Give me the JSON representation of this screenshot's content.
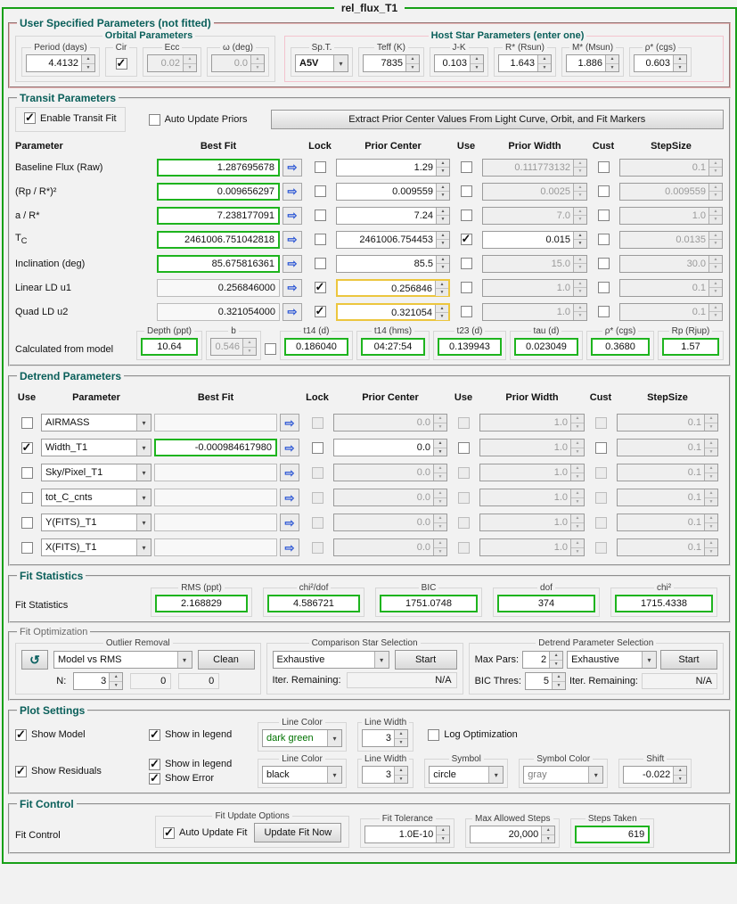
{
  "window_title": "rel_flux_T1",
  "icons": {
    "arrow_right": "⇨",
    "chevron_down": "▾",
    "undo": "↺"
  },
  "user_params": {
    "title": "User Specified Parameters (not fitted)",
    "orbital": {
      "title": "Orbital Parameters",
      "period_label": "Period (days)",
      "period_value": "4.4132",
      "cir_label": "Cir",
      "cir_checked": true,
      "ecc_label": "Ecc",
      "ecc_value": "0.02",
      "omega_label": "ω (deg)",
      "omega_value": "0.0"
    },
    "host_star": {
      "title": "Host Star Parameters (enter one)",
      "spt_label": "Sp.T.",
      "spt_value": "A5V",
      "teff_label": "Teff (K)",
      "teff_value": "7835",
      "jk_label": "J-K",
      "jk_value": "0.103",
      "rstar_label": "R* (Rsun)",
      "rstar_value": "1.643",
      "mstar_label": "M* (Msun)",
      "mstar_value": "1.886",
      "rho_label": "ρ* (cgs)",
      "rho_value": "0.603"
    }
  },
  "transit": {
    "title": "Transit Parameters",
    "enable_label": "Enable Transit Fit",
    "enable_checked": true,
    "auto_update_label": "Auto Update Priors",
    "auto_update_checked": false,
    "extract_button": "Extract Prior Center Values From Light Curve, Orbit, and Fit Markers",
    "headers": {
      "parameter": "Parameter",
      "best_fit": "Best Fit",
      "lock": "Lock",
      "prior_center": "Prior Center",
      "use": "Use",
      "prior_width": "Prior Width",
      "cust": "Cust",
      "stepsize": "StepSize"
    },
    "rows": [
      {
        "label": "Baseline Flux (Raw)",
        "best_fit": "1.287695678",
        "lock": false,
        "prior_center": "1.29",
        "use": false,
        "prior_width": "0.111773132",
        "cust": false,
        "stepsize": "0.1"
      },
      {
        "label": "(Rp / R*)²",
        "best_fit": "0.009656297",
        "lock": false,
        "prior_center": "0.009559",
        "use": false,
        "prior_width": "0.0025",
        "cust": false,
        "stepsize": "0.009559"
      },
      {
        "label": "a / R*",
        "best_fit": "7.238177091",
        "lock": false,
        "prior_center": "7.24",
        "use": false,
        "prior_width": "7.0",
        "cust": false,
        "stepsize": "1.0"
      },
      {
        "label": "T",
        "label_sub": "C",
        "best_fit": "2461006.751042818",
        "lock": false,
        "prior_center": "2461006.754453",
        "use": true,
        "prior_width": "0.015",
        "cust": false,
        "stepsize": "0.0135"
      },
      {
        "label": "Inclination (deg)",
        "best_fit": "85.675816361",
        "lock": false,
        "prior_center": "85.5",
        "use": false,
        "prior_width": "15.0",
        "cust": false,
        "stepsize": "30.0"
      },
      {
        "label": "Linear LD u1",
        "best_fit": "0.256846000",
        "lock": true,
        "prior_center": "0.256846",
        "use": false,
        "prior_width": "1.0",
        "cust": false,
        "stepsize": "0.1"
      },
      {
        "label": "Quad LD u2",
        "best_fit": "0.321054000",
        "lock": true,
        "prior_center": "0.321054",
        "use": false,
        "prior_width": "1.0",
        "cust": false,
        "stepsize": "0.1"
      }
    ],
    "calculated": {
      "label": "Calculated from model",
      "depth_label": "Depth (ppt)",
      "depth_value": "10.64",
      "b_label": "b",
      "b_value": "0.546",
      "t14d_label": "t14 (d)",
      "t14d_value": "0.186040",
      "t14hms_label": "t14 (hms)",
      "t14hms_value": "04:27:54",
      "t23_label": "t23 (d)",
      "t23_value": "0.139943",
      "tau_label": "tau (d)",
      "tau_value": "0.023049",
      "rho_label": "ρ* (cgs)",
      "rho_value": "0.3680",
      "rp_label": "Rp (Rjup)",
      "rp_value": "1.57"
    }
  },
  "detrend": {
    "title": "Detrend Parameters",
    "headers": {
      "use_left": "Use",
      "parameter": "Parameter",
      "best_fit": "Best Fit",
      "lock": "Lock",
      "prior_center": "Prior Center",
      "use": "Use",
      "prior_width": "Prior Width",
      "cust": "Cust",
      "stepsize": "StepSize"
    },
    "rows": [
      {
        "enabled": false,
        "param": "AIRMASS",
        "best_fit": "",
        "prior_center": "0.0",
        "prior_width": "1.0",
        "stepsize": "0.1"
      },
      {
        "enabled": true,
        "param": "Width_T1",
        "best_fit": "-0.000984617980",
        "prior_center": "0.0",
        "prior_width": "1.0",
        "stepsize": "0.1"
      },
      {
        "enabled": false,
        "param": "Sky/Pixel_T1",
        "best_fit": "",
        "prior_center": "0.0",
        "prior_width": "1.0",
        "stepsize": "0.1"
      },
      {
        "enabled": false,
        "param": "tot_C_cnts",
        "best_fit": "",
        "prior_center": "0.0",
        "prior_width": "1.0",
        "stepsize": "0.1"
      },
      {
        "enabled": false,
        "param": "Y(FITS)_T1",
        "best_fit": "",
        "prior_center": "0.0",
        "prior_width": "1.0",
        "stepsize": "0.1"
      },
      {
        "enabled": false,
        "param": "X(FITS)_T1",
        "best_fit": "",
        "prior_center": "0.0",
        "prior_width": "1.0",
        "stepsize": "0.1"
      }
    ]
  },
  "fit_statistics": {
    "title": "Fit Statistics",
    "label": "Fit Statistics",
    "rms_label": "RMS (ppt)",
    "rms_value": "2.168829",
    "chi2dof_label": "chi²/dof",
    "chi2dof_value": "4.586721",
    "bic_label": "BIC",
    "bic_value": "1751.0748",
    "dof_label": "dof",
    "dof_value": "374",
    "chi2_label": "chi²",
    "chi2_value": "1715.4338"
  },
  "fit_optimization": {
    "title": "Fit Optimization",
    "outlier": {
      "title": "Outlier Removal",
      "method_value": "Model vs RMS",
      "clean_button": "Clean",
      "n_label": "N:",
      "n_value": "3",
      "removed_value": "0",
      "remaining_value": "0"
    },
    "comparison": {
      "title": "Comparison Star Selection",
      "method_value": "Exhaustive",
      "start_button": "Start",
      "iter_label": "Iter. Remaining:",
      "iter_value": "N/A"
    },
    "detrend_sel": {
      "title": "Detrend Parameter Selection",
      "max_pars_label": "Max Pars:",
      "max_pars_value": "2",
      "method_value": "Exhaustive",
      "start_button": "Start",
      "bic_label": "BIC Thres:",
      "bic_value": "5",
      "iter_label": "Iter. Remaining:",
      "iter_value": "N/A"
    }
  },
  "plot_settings": {
    "title": "Plot Settings",
    "show_model_label": "Show Model",
    "show_model_checked": true,
    "model_legend_label": "Show in legend",
    "model_legend_checked": true,
    "model_line_color_title": "Line Color",
    "model_line_color_value": "dark green",
    "model_line_width_title": "Line Width",
    "model_line_width_value": "3",
    "log_opt_label": "Log Optimization",
    "log_opt_checked": false,
    "show_residuals_label": "Show Residuals",
    "show_residuals_checked": true,
    "res_legend_label": "Show in legend",
    "res_legend_checked": true,
    "show_error_label": "Show Error",
    "show_error_checked": true,
    "res_line_color_title": "Line Color",
    "res_line_color_value": "black",
    "res_line_width_title": "Line Width",
    "res_line_width_value": "3",
    "symbol_title": "Symbol",
    "symbol_value": "circle",
    "symbol_color_title": "Symbol Color",
    "symbol_color_value": "gray",
    "shift_title": "Shift",
    "shift_value": "-0.022"
  },
  "fit_control": {
    "title": "Fit Control",
    "label": "Fit Control",
    "update_options_title": "Fit Update Options",
    "auto_update_label": "Auto Update Fit",
    "auto_update_checked": true,
    "update_now_button": "Update Fit Now",
    "tolerance_title": "Fit Tolerance",
    "tolerance_value": "1.0E-10",
    "max_steps_title": "Max Allowed Steps",
    "max_steps_value": "20,000",
    "steps_taken_title": "Steps Taken",
    "steps_taken_value": "619"
  },
  "colors": {
    "window_border": "#17a017",
    "section_title": "#0a5f5a",
    "fitted_value_border": "#1eb41e",
    "locked_prior_border": "#ecc63e",
    "host_star_border": "#f3c3ce",
    "model_line_color_text": "#007200"
  }
}
